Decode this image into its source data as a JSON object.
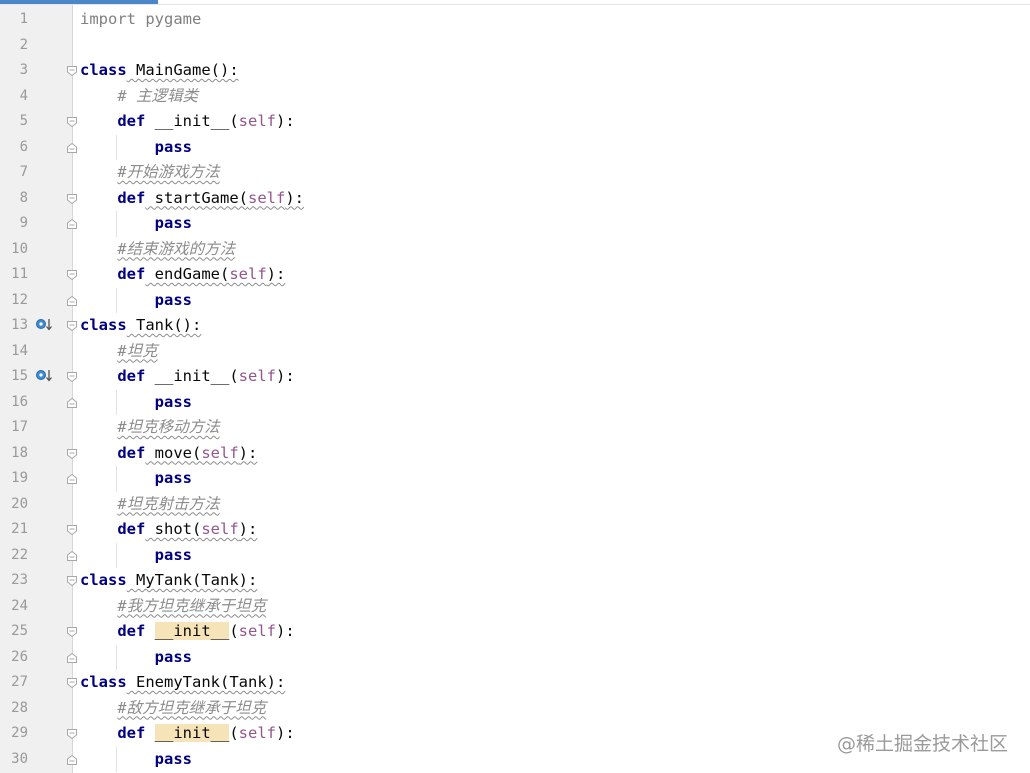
{
  "editor": {
    "language": "python",
    "colors": {
      "keyword": "#000080",
      "self_param": "#94558d",
      "comment": "#8c8c8c",
      "highlight": "#f6e4b8",
      "gutter_bg": "#f0f0f0"
    },
    "lines": [
      {
        "n": "1",
        "tokens": [
          {
            "t": "import",
            "c": "imp"
          },
          {
            "t": " pygame",
            "c": "imp"
          }
        ],
        "fold": "",
        "icon": ""
      },
      {
        "n": "2",
        "tokens": [],
        "fold": "",
        "icon": ""
      },
      {
        "n": "3",
        "tokens": [
          {
            "t": "class",
            "c": "kw"
          },
          {
            "t": " MainGame():",
            "c": "",
            "w": true
          }
        ],
        "fold": "open",
        "icon": ""
      },
      {
        "n": "4",
        "tokens": [
          {
            "t": "    "
          },
          {
            "t": "# 主逻辑类",
            "c": "cmt"
          }
        ],
        "fold": "",
        "icon": ""
      },
      {
        "n": "5",
        "tokens": [
          {
            "t": "    "
          },
          {
            "t": "def",
            "c": "kw"
          },
          {
            "t": " __init__("
          },
          {
            "t": "self",
            "c": "selfp"
          },
          {
            "t": "):"
          }
        ],
        "fold": "open",
        "icon": ""
      },
      {
        "n": "6",
        "tokens": [
          {
            "t": "        "
          },
          {
            "t": "pass",
            "c": "kw"
          }
        ],
        "fold": "close",
        "icon": ""
      },
      {
        "n": "7",
        "tokens": [
          {
            "t": "    "
          },
          {
            "t": "#开始游戏方法",
            "c": "cmt",
            "w": true
          }
        ],
        "fold": "",
        "icon": ""
      },
      {
        "n": "8",
        "tokens": [
          {
            "t": "    "
          },
          {
            "t": "def",
            "c": "kw"
          },
          {
            "t": " startGame(",
            "w": true
          },
          {
            "t": "self",
            "c": "selfp",
            "w": true
          },
          {
            "t": "):",
            "w": true
          }
        ],
        "fold": "open",
        "icon": ""
      },
      {
        "n": "9",
        "tokens": [
          {
            "t": "        "
          },
          {
            "t": "pass",
            "c": "kw"
          }
        ],
        "fold": "close",
        "icon": ""
      },
      {
        "n": "10",
        "tokens": [
          {
            "t": "    "
          },
          {
            "t": "#结束游戏的方法",
            "c": "cmt",
            "w": true
          }
        ],
        "fold": "",
        "icon": ""
      },
      {
        "n": "11",
        "tokens": [
          {
            "t": "    "
          },
          {
            "t": "def",
            "c": "kw"
          },
          {
            "t": " endGame(",
            "w": true
          },
          {
            "t": "self",
            "c": "selfp",
            "w": true
          },
          {
            "t": "):",
            "w": true
          }
        ],
        "fold": "open",
        "icon": ""
      },
      {
        "n": "12",
        "tokens": [
          {
            "t": "        "
          },
          {
            "t": "pass",
            "c": "kw"
          }
        ],
        "fold": "close",
        "icon": ""
      },
      {
        "n": "13",
        "tokens": [
          {
            "t": "class",
            "c": "kw"
          },
          {
            "t": " Tank():",
            "w": true
          }
        ],
        "fold": "open",
        "icon": "overridden-method-icon"
      },
      {
        "n": "14",
        "tokens": [
          {
            "t": "    "
          },
          {
            "t": "#坦克",
            "c": "cmt",
            "w": true
          }
        ],
        "fold": "",
        "icon": ""
      },
      {
        "n": "15",
        "tokens": [
          {
            "t": "    "
          },
          {
            "t": "def",
            "c": "kw"
          },
          {
            "t": " __init__("
          },
          {
            "t": "self",
            "c": "selfp"
          },
          {
            "t": "):"
          }
        ],
        "fold": "open",
        "icon": "overridden-method-icon"
      },
      {
        "n": "16",
        "tokens": [
          {
            "t": "        "
          },
          {
            "t": "pass",
            "c": "kw"
          }
        ],
        "fold": "close",
        "icon": ""
      },
      {
        "n": "17",
        "tokens": [
          {
            "t": "    "
          },
          {
            "t": "#坦克移动方法",
            "c": "cmt",
            "w": true
          }
        ],
        "fold": "",
        "icon": ""
      },
      {
        "n": "18",
        "tokens": [
          {
            "t": "    "
          },
          {
            "t": "def",
            "c": "kw"
          },
          {
            "t": " move(",
            "w": true
          },
          {
            "t": "self",
            "c": "selfp",
            "w": true
          },
          {
            "t": "):",
            "w": true
          }
        ],
        "fold": "open",
        "icon": ""
      },
      {
        "n": "19",
        "tokens": [
          {
            "t": "        "
          },
          {
            "t": "pass",
            "c": "kw"
          }
        ],
        "fold": "close",
        "icon": ""
      },
      {
        "n": "20",
        "tokens": [
          {
            "t": "    "
          },
          {
            "t": "#坦克射击方法",
            "c": "cmt",
            "w": true
          }
        ],
        "fold": "",
        "icon": ""
      },
      {
        "n": "21",
        "tokens": [
          {
            "t": "    "
          },
          {
            "t": "def",
            "c": "kw"
          },
          {
            "t": " shot(",
            "w": true
          },
          {
            "t": "self",
            "c": "selfp",
            "w": true
          },
          {
            "t": "):",
            "w": true
          }
        ],
        "fold": "open",
        "icon": ""
      },
      {
        "n": "22",
        "tokens": [
          {
            "t": "        "
          },
          {
            "t": "pass",
            "c": "kw"
          }
        ],
        "fold": "close",
        "icon": ""
      },
      {
        "n": "23",
        "tokens": [
          {
            "t": "class",
            "c": "kw"
          },
          {
            "t": " MyTank(Tank):",
            "w": true
          }
        ],
        "fold": "open",
        "icon": ""
      },
      {
        "n": "24",
        "tokens": [
          {
            "t": "    "
          },
          {
            "t": "#我方坦克继承于坦克",
            "c": "cmt",
            "w": true
          }
        ],
        "fold": "",
        "icon": ""
      },
      {
        "n": "25",
        "tokens": [
          {
            "t": "    "
          },
          {
            "t": "def",
            "c": "kw"
          },
          {
            "t": " "
          },
          {
            "t": "__init__",
            "c": "hl"
          },
          {
            "t": "("
          },
          {
            "t": "self",
            "c": "selfp"
          },
          {
            "t": "):"
          }
        ],
        "fold": "open",
        "icon": ""
      },
      {
        "n": "26",
        "tokens": [
          {
            "t": "        "
          },
          {
            "t": "pass",
            "c": "kw"
          }
        ],
        "fold": "close",
        "icon": ""
      },
      {
        "n": "27",
        "tokens": [
          {
            "t": "class",
            "c": "kw"
          },
          {
            "t": " EnemyTank(Tank):",
            "w": true
          }
        ],
        "fold": "open",
        "icon": ""
      },
      {
        "n": "28",
        "tokens": [
          {
            "t": "    "
          },
          {
            "t": "#敌方坦克继承于坦克",
            "c": "cmt",
            "w": true
          }
        ],
        "fold": "",
        "icon": ""
      },
      {
        "n": "29",
        "tokens": [
          {
            "t": "    "
          },
          {
            "t": "def",
            "c": "kw"
          },
          {
            "t": " "
          },
          {
            "t": "__init__",
            "c": "hl"
          },
          {
            "t": "("
          },
          {
            "t": "self",
            "c": "selfp"
          },
          {
            "t": "):"
          }
        ],
        "fold": "open",
        "icon": ""
      },
      {
        "n": "30",
        "tokens": [
          {
            "t": "        "
          },
          {
            "t": "pass",
            "c": "kw"
          }
        ],
        "fold": "close",
        "icon": ""
      }
    ]
  },
  "watermark": "@稀土掘金技术社区"
}
